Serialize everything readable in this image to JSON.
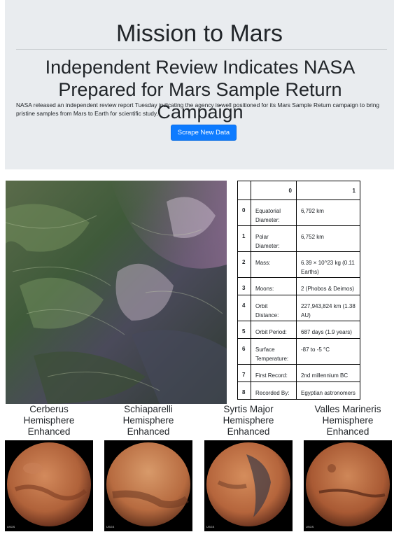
{
  "jumbotron": {
    "title": "Mission to Mars",
    "news_title": "Independent Review Indicates NASA Prepared for Mars Sample Return Campaign",
    "news_paragraph": "NASA released an independent review report Tuesday indicating the agency is well positioned for its Mars Sample Return campaign to bring pristine samples from Mars to Earth for scientific study.",
    "scrape_button": "Scrape New Data"
  },
  "featured_image": {
    "icon": "mars-terrain-image"
  },
  "facts": {
    "headers": [
      "",
      "0",
      "1"
    ],
    "rows": [
      {
        "index": "0",
        "label": "Equatorial Diameter:",
        "value": "6,792 km"
      },
      {
        "index": "1",
        "label": "Polar Diameter:",
        "value": "6,752 km"
      },
      {
        "index": "2",
        "label": "Mass:",
        "value": "6.39 × 10^23 kg (0.11 Earths)"
      },
      {
        "index": "3",
        "label": "Moons:",
        "value": "2 (Phobos & Deimos)"
      },
      {
        "index": "4",
        "label": "Orbit Distance:",
        "value": "227,943,824 km (1.38 AU)"
      },
      {
        "index": "5",
        "label": "Orbit Period:",
        "value": "687 days (1.9 years)"
      },
      {
        "index": "6",
        "label": "Surface Temperature:",
        "value": "-87 to -5 °C"
      },
      {
        "index": "7",
        "label": "First Record:",
        "value": "2nd millennium BC"
      },
      {
        "index": "8",
        "label": "Recorded By:",
        "value": "Egyptian astronomers"
      }
    ]
  },
  "hemispheres": [
    {
      "title": "Cerberus Hemisphere Enhanced",
      "logo": "USGS"
    },
    {
      "title": "Schiaparelli Hemisphere Enhanced",
      "logo": "USGS"
    },
    {
      "title": "Syrtis Major Hemisphere Enhanced",
      "logo": "USGS"
    },
    {
      "title": "Valles Marineris Hemisphere Enhanced",
      "logo": "USGS"
    }
  ],
  "colors": {
    "jumbotron_bg": "#e9ecef",
    "button_primary": "#0d7bff",
    "mars_orange": "#b8643a"
  }
}
